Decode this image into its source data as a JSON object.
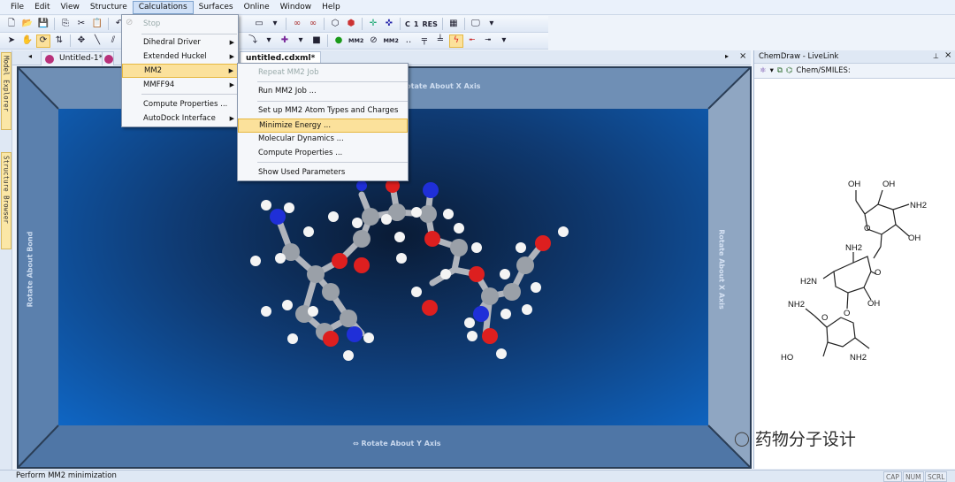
{
  "menubar": [
    "File",
    "Edit",
    "View",
    "Structure",
    "Calculations",
    "Surfaces",
    "Online",
    "Window",
    "Help"
  ],
  "toolbar1": {
    "c_label": "C",
    "one_label": "1",
    "res_label": "RES"
  },
  "toolbar2": {
    "mm2_label": "MM2",
    "mm2b_label": "MM2"
  },
  "left_tabs": [
    "Model Explorer",
    "Structure Browser"
  ],
  "doc_tabs": {
    "tab1": "Untitled-1*",
    "tab2": "untitled.cdxml*"
  },
  "viewport_labels": {
    "top": "Rotate About X Axis",
    "bottom": "Rotate About Y Axis",
    "left": "Rotate About Bond",
    "right": "Rotate About X Axis"
  },
  "calc_menu": [
    "Stop",
    "Dihedral Driver",
    "Extended Huckel",
    "MM2",
    "MMFF94",
    "Compute Properties ...",
    "AutoDock Interface"
  ],
  "mm2_menu": [
    "Repeat MM2 Job",
    "Run MM2 Job ...",
    "Set up MM2 Atom Types and Charges",
    "Minimize Energy ...",
    "Molecular Dynamics ...",
    "Compute Properties ...",
    "Show Used Parameters"
  ],
  "side_panel": {
    "title": "ChemDraw - LiveLink",
    "smiles_label": "Chem/SMILES:"
  },
  "structure_labels": {
    "oh1": "OH",
    "oh2": "OH",
    "nh2a": "NH2",
    "oh3": "OH",
    "nh2b": "NH2",
    "o1": "O",
    "o2": "O",
    "nh2c": "H2N",
    "oh4": "OH",
    "o3": "O",
    "nh2d": "NH2",
    "o4": "O",
    "ho": "HO",
    "nh2e": "NH2"
  },
  "status": {
    "text": "Perform MM2 minimization",
    "cap": "CAP",
    "num": "NUM",
    "scrl": "SCRL"
  },
  "watermark": "药物分子设计"
}
